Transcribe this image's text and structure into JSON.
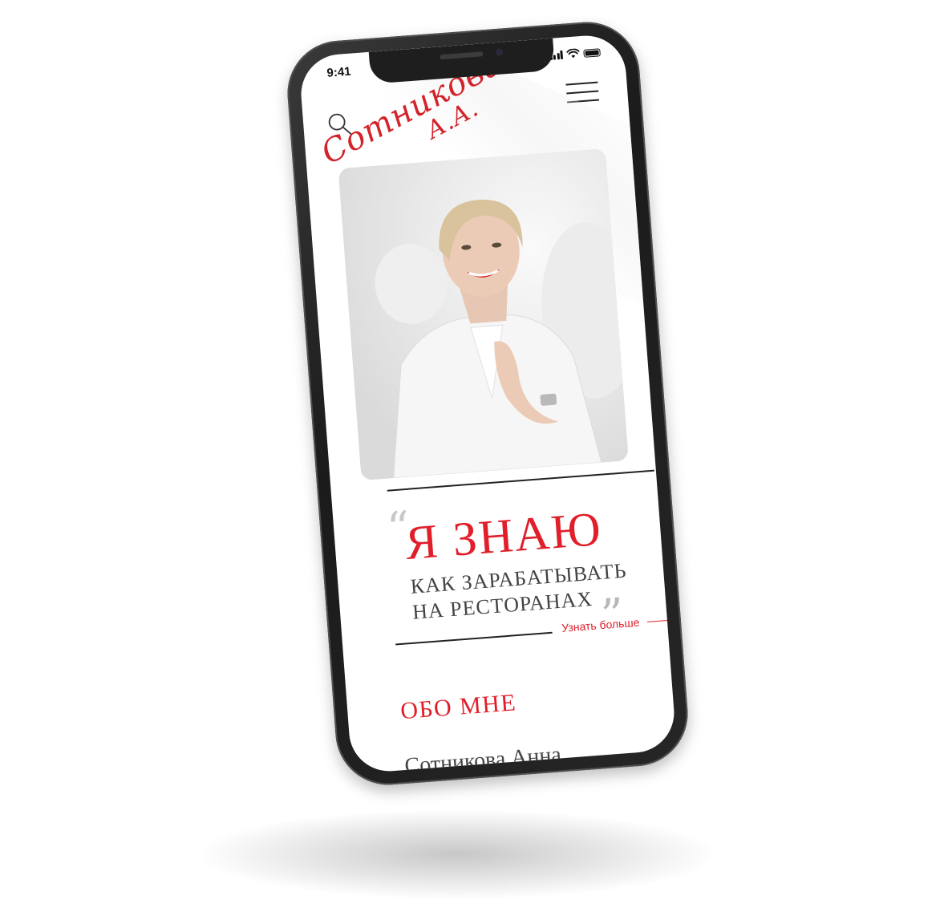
{
  "status_bar": {
    "time": "9:41"
  },
  "header": {
    "search_icon": "search-icon",
    "menu_icon": "hamburger-menu-icon"
  },
  "hero": {
    "signature_name": "Сотникова",
    "signature_initials": "А.А.",
    "photo_alt": "portrait photo"
  },
  "quote": {
    "headline": "Я ЗНАЮ",
    "line1": "КАК ЗАРАБАТЫВАТЬ",
    "line2": "НА РЕСТОРАНАХ",
    "open_mark": "“",
    "close_mark": "”"
  },
  "cta": {
    "label": "Узнать больше"
  },
  "about": {
    "title": "ОБО МНЕ",
    "name": "Сотникова Анна"
  },
  "colors": {
    "accent": "#e01f2a",
    "text": "#444444",
    "frame": "#1e1e1e"
  }
}
